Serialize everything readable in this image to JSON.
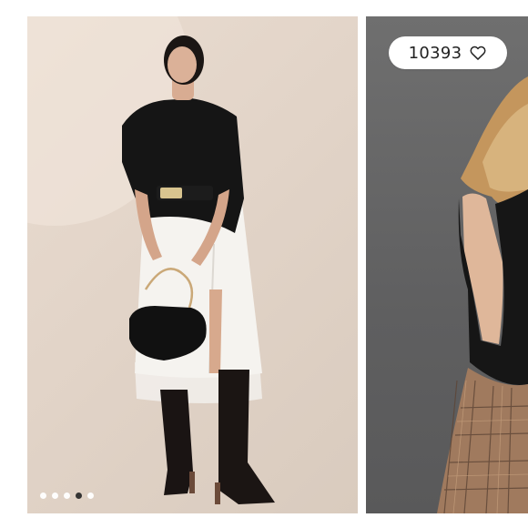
{
  "gallery": {
    "slides": [
      {
        "description_name": "model-black-top-white-skirt"
      },
      {
        "description_name": "model-plaid-skirt"
      }
    ],
    "pagination": {
      "total": 5,
      "active_index": 3
    },
    "likes": {
      "count": "10393",
      "icon": "heart-outline-icon"
    }
  },
  "colors": {
    "active_dot": "#2b2b2b",
    "inactive_dot": "#ffffff"
  }
}
